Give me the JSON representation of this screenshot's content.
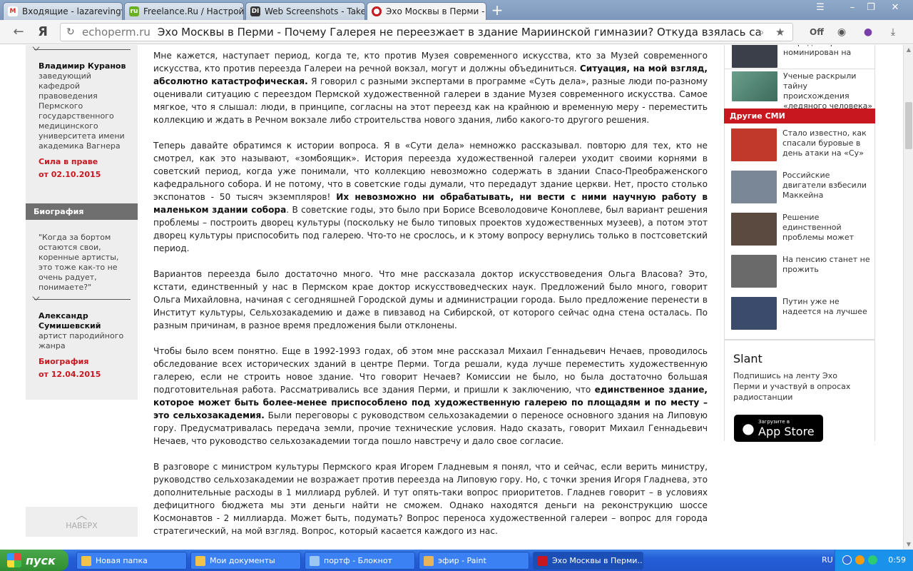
{
  "browser": {
    "tabs": [
      {
        "label": "Входящие - lazarevingv",
        "icon_text": "M",
        "icon_color": "#d93025"
      },
      {
        "label": "Freelance.Ru / Настрой",
        "icon_text": "ru",
        "icon_color": "#6ab023"
      },
      {
        "label": "Web Screenshots - Take",
        "icon_text": "DI",
        "icon_color": "#333333"
      },
      {
        "label": "Эхо Москвы в Перми - Г",
        "icon_text": "",
        "icon_color": "#c8171f"
      }
    ],
    "new_tab_label": "+",
    "address": {
      "domain": "echoperm.ru",
      "title": "Эхо Москвы в Перми - Почему Галерея не переезжает в здание Мариинской гимназии? Откуда взялась сальмоне..."
    },
    "toolbar_off_label": "Off"
  },
  "left": {
    "person1": {
      "name": "Владимир Куранов",
      "desc": "заведующий кафедрой правоведения Пермского государственного медицинского университета имени академика Вагнера",
      "link": "Сила в праве",
      "date": "от 02.10.2015"
    },
    "bio_header": "Биография",
    "quote": "\"Когда за бортом остаются свои, коренные артисты, это тоже как-то не очень радует, понимаете?\"",
    "person2": {
      "name": "Александр Сумишевский",
      "desc": "артист пародийного жанра",
      "link": "Биография",
      "date": "от 12.04.2015"
    },
    "more_label": "НАВЕРХ"
  },
  "article": {
    "paragraphs": [
      [
        {
          "t": "Мне кажется, наступает период, когда те, кто против Музея современного искусства, кто за Музей современного искусства, кто против переезда Галереи на речной вокзал, могут и должны объединиться. ",
          "b": false
        },
        {
          "t": "Ситуация, на мой взгляд, абсолютно катастрофическая.",
          "b": true
        },
        {
          "t": " Я говорил с разными экспертами в программе «Суть дела», разные люди по-разному оценивали ситуацию с переездом Пермской художественной галереи в здание Музея современного искусства. Самое мягкое, что я слышал: люди, в принципе, согласны на этот переезд как на крайнюю и временную меру - переместить коллекцию и ждать в Речном вокзале либо строительства нового здания, либо какого-то другого решения.",
          "b": false
        }
      ],
      [
        {
          "t": "Теперь давайте обратимся к истории вопроса. Я в «Сути дела» немножко рассказывал. повторю для тех, кто не смотрел, как это называют, «зомбоящик». История переезда художественной галереи уходит своими корнями в советский период, когда уже понимали, что коллекцию невозможно содержать в здании Спасо-Преображенского кафедрального собора. И не потому, что в советские годы думали, что передадут здание церкви. Нет, просто столько экспонатов - 50 тысяч экземпляров! ",
          "b": false
        },
        {
          "t": "Их невозможно ни обрабатывать, ни вести с ними научную работу в маленьком здании собора",
          "b": true
        },
        {
          "t": ". В советские годы, это было при Борисе Всеволодовиче Коноплеве, был вариант решения проблемы – построить дворец культуры (поскольку не было типовых проектов художественных музеев), а потом этот дворец культуры приспособить под галерею. Что-то не срослось, и к этому вопросу вернулись только в постсоветский период.",
          "b": false
        }
      ],
      [
        {
          "t": "Вариантов переезда было достаточно много. Что мне рассказала доктор искусствоведения Ольга Власова? Это, кстати, единственный у нас в Пермском крае доктор искусствоведческих наук. Предложений было много, говорит Ольга Михайловна, начиная с сегодняшней Городской думы и администрации города. Было предложение перенести в Институт культуры, Сельхозакадемию и даже в пивзавод на Сибирской, от которого сейчас одна стена осталась. По разным причинам, в разное время предложения были отклонены.",
          "b": false
        }
      ],
      [
        {
          "t": "Чтобы было всем понятно. Еще в 1992-1993 годах, об этом мне рассказал Михаил Геннадьевич Нечаев, проводилось обследование всех исторических зданий в центре Перми. Тогда решали, куда лучше переместить художественную галерею, если не строить новое здание. Что говорит Нечаев? Комиссии не было, но была достаточно большая подготовительная работа. Рассматривались все здания Перми, и пришли к заключению, что ",
          "b": false
        },
        {
          "t": "единственное здание, которое может быть более-менее приспособлено под художественную галерею по площадям и по месту – это сельхозакадемия.",
          "b": true
        },
        {
          "t": " Были переговоры с руководством сельхозакадемии о переносе основного здания на Липовую гору. Предусматривалась передача земли, прочие технические условия. Надо сказать, говорит Михаил Геннадьевич Нечаев, что руководство сельхозакадемии тогда пошло навстречу и дало свое согласие.",
          "b": false
        }
      ],
      [
        {
          "t": "В разговоре с министром культуры Пермского края Игорем Гладневым я понял, что и сейчас, если верить министру, руководство сельхозакадемии не возражает против переезда на Липовую гору. Но, с точки зрения Игоря Гладнева, это дополнительные расходы в 1 миллиард рублей. И тут опять-таки вопрос приоритетов. Гладнев говорит – в условиях дефицитного бюджета мы эти деньги найти не сможем. Однако находятся деньги на реконструкцию шоссе Космонавтов - 2 миллиарда. Может быть, подумать? Вопрос переноса художественной галереи – вопрос для города стратегический, на мой взгляд. Вопрос, который касается каждого из нас.",
          "b": false
        }
      ]
    ]
  },
  "right": {
    "top_news": [
      {
        "text": "очередной раз номинирован на",
        "color": "#3a3f4a"
      },
      {
        "text": "Ученые раскрыли тайну происхождения «ледяного человека»",
        "color": "#4a7a6a"
      }
    ],
    "other_media_header": "Другие СМИ",
    "other_media": [
      {
        "text": "Стало известно, как спасали буровые в день атаки на «Су»",
        "color": "#c0392b"
      },
      {
        "text": "Российские двигатели взбесили Маккейна",
        "color": "#7a8797"
      },
      {
        "text": "Решение единственной проблемы может",
        "color": "#5b4a3f"
      },
      {
        "text": "На пенсию станет не прожить",
        "color": "#6a6a6a"
      },
      {
        "text": "Путин уже не надеется на лучшее",
        "color": "#3b4b6b"
      }
    ],
    "slant": {
      "title": "Slant",
      "text": "Подпишись на ленту Эхо Перми и участвуй в опросах радиостанции",
      "store_small": "Загрузите в",
      "store_big": "App Store"
    }
  },
  "taskbar": {
    "start_label": "пуск",
    "items": [
      {
        "label": "Новая папка",
        "icon_color": "#f3c24a"
      },
      {
        "label": "Мои документы",
        "icon_color": "#f3c24a"
      },
      {
        "label": "портф - Блокнот",
        "icon_color": "#9cc7f0"
      },
      {
        "label": "эфир - Paint",
        "icon_color": "#e8b45a"
      },
      {
        "label": "Эхо Москвы в Перми...",
        "icon_color": "#c8171f"
      }
    ],
    "lang": "RU",
    "clock": "0:59"
  },
  "colors": {
    "accent_red": "#c8171f",
    "taskbar_blue": "#245ed6"
  }
}
